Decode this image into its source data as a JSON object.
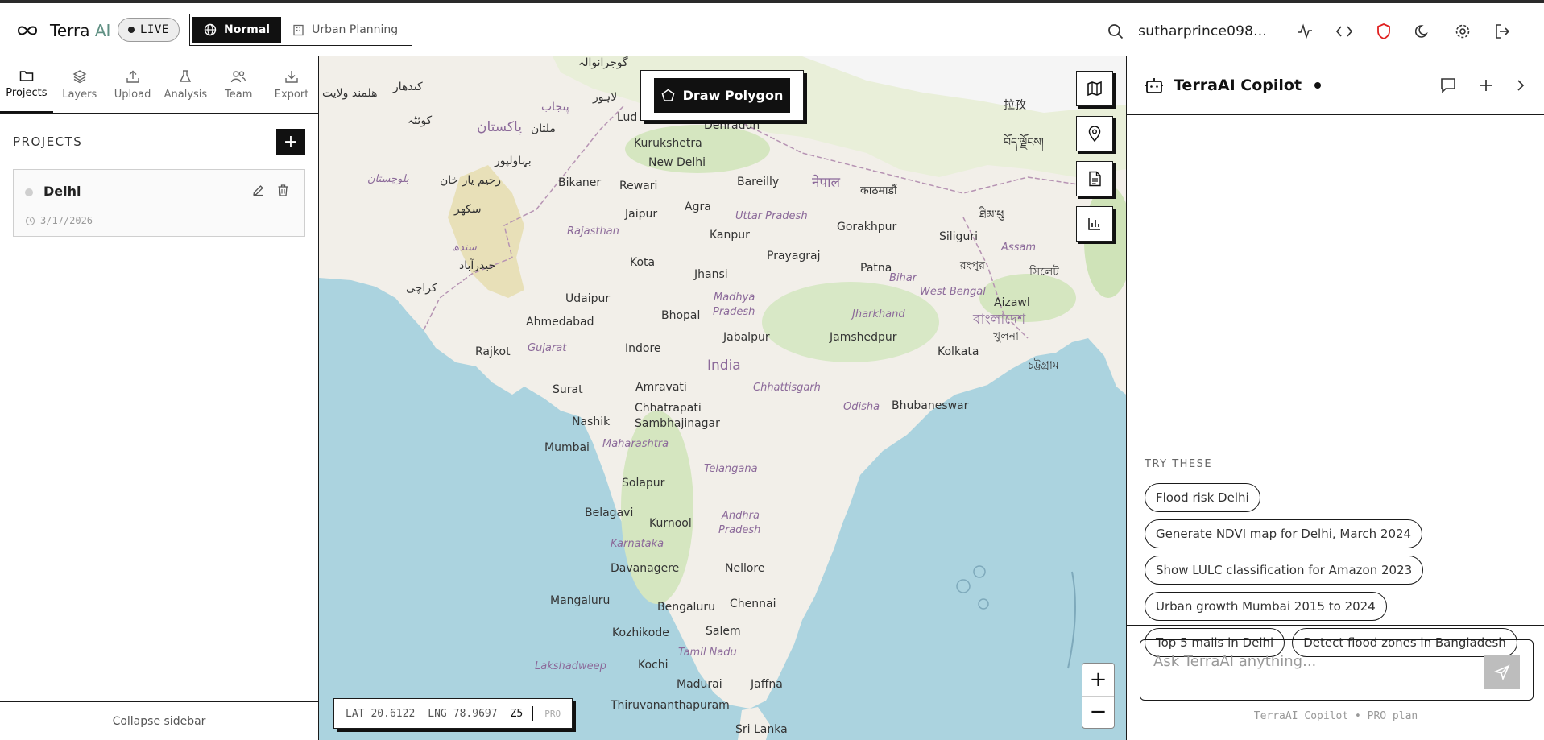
{
  "app": {
    "name_main": "Terra",
    "name_accent": " AI",
    "live_label": "LIVE"
  },
  "modes": [
    {
      "label": "Normal",
      "active": true,
      "icon": "globe-icon"
    },
    {
      "label": "Urban Planning",
      "active": false,
      "icon": "building-icon"
    }
  ],
  "header": {
    "username": "sutharprince098..."
  },
  "sidebar": {
    "tabs": [
      {
        "label": "Projects",
        "icon": "folder-icon",
        "active": true
      },
      {
        "label": "Layers",
        "icon": "layers-icon"
      },
      {
        "label": "Upload",
        "icon": "upload-icon"
      },
      {
        "label": "Analysis",
        "icon": "flask-icon"
      },
      {
        "label": "Team",
        "icon": "users-icon"
      },
      {
        "label": "Export",
        "icon": "download-icon"
      }
    ],
    "projects_title": "PROJECTS",
    "add_label": "+",
    "projects": [
      {
        "name": "Delhi",
        "date": "3/17/2026"
      }
    ],
    "collapse_label": "Collapse sidebar"
  },
  "map": {
    "draw_label": "Draw Polygon",
    "coords": {
      "lat_label": "LAT",
      "lat": "20.6122",
      "lng_label": "LNG",
      "lng": "78.9697",
      "zoom": "Z5",
      "plan": "PRO"
    },
    "zoom_in": "+",
    "zoom_out": "−",
    "cities": [
      {
        "t": "Dehradun"
      },
      {
        "t": "Kurukshetra"
      },
      {
        "t": "New Delhi"
      },
      {
        "t": "Bareilly"
      },
      {
        "t": "Bikaner"
      },
      {
        "t": "Rewari"
      },
      {
        "t": "Agra"
      },
      {
        "t": "Jaipur"
      },
      {
        "t": "Gorakhpur"
      },
      {
        "t": "Siliguri"
      },
      {
        "t": "Kanpur"
      },
      {
        "t": "Prayagraj"
      },
      {
        "t": "Kota"
      },
      {
        "t": "Patna"
      },
      {
        "t": "Jhansi"
      },
      {
        "t": "Udaipur"
      },
      {
        "t": "Ahmedabad"
      },
      {
        "t": "Bhopal"
      },
      {
        "t": "Jabalpur"
      },
      {
        "t": "Jamshedpur"
      },
      {
        "t": "Kolkata"
      },
      {
        "t": "Rajkot"
      },
      {
        "t": "Indore"
      },
      {
        "t": "Amravati"
      },
      {
        "t": "Surat"
      },
      {
        "t": "Chhatrapati"
      },
      {
        "t": "Sambhajinagar"
      },
      {
        "t": "Nashik"
      },
      {
        "t": "Bhubaneswar"
      },
      {
        "t": "Mumbai"
      },
      {
        "t": "Solapur"
      },
      {
        "t": "Belagavi"
      },
      {
        "t": "Kurnool"
      },
      {
        "t": "Davanagere"
      },
      {
        "t": "Nellore"
      },
      {
        "t": "Mangaluru"
      },
      {
        "t": "Bengaluru"
      },
      {
        "t": "Chennai"
      },
      {
        "t": "Kozhikode"
      },
      {
        "t": "Salem"
      },
      {
        "t": "Kochi"
      },
      {
        "t": "Madurai"
      },
      {
        "t": "Jaffna"
      },
      {
        "t": "Thiruvananthapuram"
      },
      {
        "t": "Sri Lanka"
      },
      {
        "t": "Lud"
      },
      {
        "t": "Aizawl"
      }
    ],
    "states": [
      {
        "t": "Uttar Pradesh"
      },
      {
        "t": "Rajasthan"
      },
      {
        "t": "Madhya"
      },
      {
        "t": "Pradesh"
      },
      {
        "t": "Bihar"
      },
      {
        "t": "Assam"
      },
      {
        "t": "West Bengal"
      },
      {
        "t": "Jharkhand"
      },
      {
        "t": "Gujarat"
      },
      {
        "t": "Chhattisgarh"
      },
      {
        "t": "Odisha"
      },
      {
        "t": "Maharashtra"
      },
      {
        "t": "Telangana"
      },
      {
        "t": "Andhra"
      },
      {
        "t": "Pradesh"
      },
      {
        "t": "Karnataka"
      },
      {
        "t": "Tamil Nadu"
      },
      {
        "t": "Lakshadweep"
      }
    ],
    "country_label": "India",
    "foreign_labels": [
      {
        "t": "گوجرانوالہ"
      },
      {
        "t": "کندھار"
      },
      {
        "t": "ھلمند ولایت"
      },
      {
        "t": "لاہور"
      },
      {
        "t": "پنجاب"
      },
      {
        "t": "کوئٹہ"
      },
      {
        "t": "پاکستان"
      },
      {
        "t": "ملتان"
      },
      {
        "t": "بہاولپور"
      },
      {
        "t": "بلوچستان"
      },
      {
        "t": "رحیم یار خان"
      },
      {
        "t": "سکھر"
      },
      {
        "t": "سندھ"
      },
      {
        "t": "حیدرآباد"
      },
      {
        "t": "کراچی"
      },
      {
        "t": "नेपाल"
      },
      {
        "t": "काठमाडौं"
      },
      {
        "t": "བོད་ལྗོངས།"
      },
      {
        "t": "拉孜"
      },
      {
        "t": "বাংলাদেশ"
      },
      {
        "t": "খুলনা"
      },
      {
        "t": "চট্টগ্রাম"
      },
      {
        "t": "রংপুর"
      },
      {
        "t": "সিলেট"
      },
      {
        "t": "ཐིམ་ཕུ"
      }
    ]
  },
  "copilot": {
    "title": "TerraAI Copilot",
    "try_label": "TRY THESE",
    "suggestions": [
      "Flood risk Delhi",
      "Generate NDVI map for Delhi, March 2024",
      "Show LULC classification for Amazon 2023",
      "Urban growth Mumbai 2015 to 2024",
      "Top 5 malls in Delhi",
      "Detect flood zones in Bangladesh"
    ],
    "input_placeholder": "Ask TerraAI anything...",
    "footnote": "TerraAI Copilot • PRO plan"
  }
}
